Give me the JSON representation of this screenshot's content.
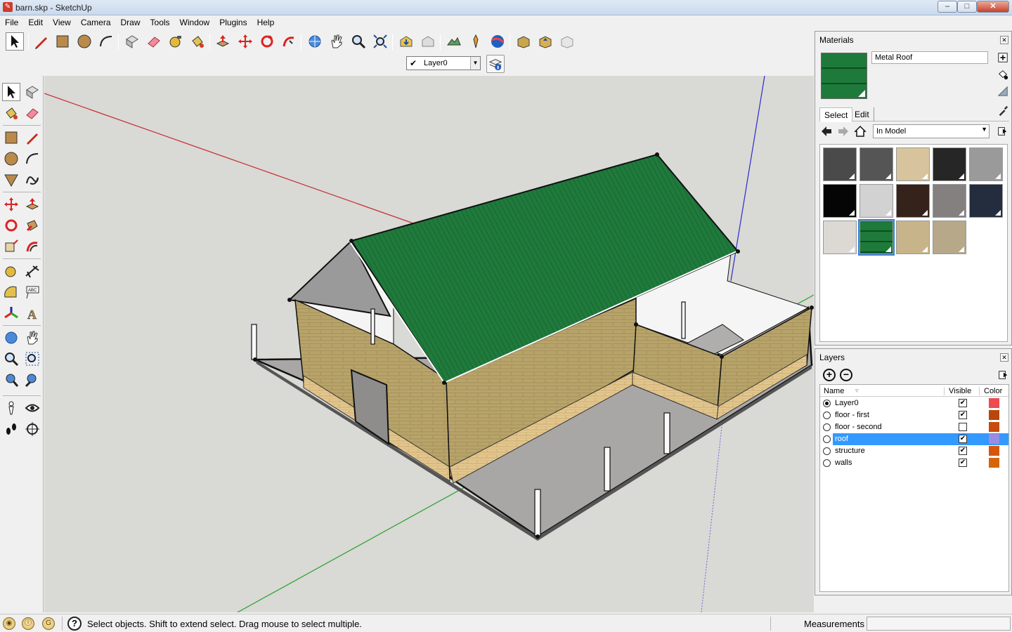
{
  "window": {
    "title": "barn.skp - SketchUp",
    "min": "‒",
    "max": "□",
    "close": "✕"
  },
  "menu": [
    "File",
    "Edit",
    "View",
    "Camera",
    "Draw",
    "Tools",
    "Window",
    "Plugins",
    "Help"
  ],
  "layer_toolbar": {
    "current_layer": "Layer0",
    "visible_check": "✔"
  },
  "status": {
    "help_glyph": "?",
    "message": "Select objects. Shift to extend select. Drag mouse to select multiple.",
    "measurements_label": "Measurements",
    "measurements_value": ""
  },
  "materials": {
    "panel_title": "Materials",
    "close": "✕",
    "selected_name": "Metal Roof",
    "tabs": [
      "Select",
      "Edit"
    ],
    "library": "In Model",
    "swatches": [
      {
        "color": "#4a4a4a"
      },
      {
        "color": "#555555"
      },
      {
        "color": "#d8c49c"
      },
      {
        "color": "#262626"
      },
      {
        "color": "#9a9a9a"
      },
      {
        "color": "#050505"
      },
      {
        "color": "#d2d2d2"
      },
      {
        "color": "#35221a"
      },
      {
        "color": "#858080"
      },
      {
        "color": "#232d3e"
      },
      {
        "color": "#dcd8d4"
      },
      {
        "color": "#1e7a3a",
        "selected": true
      },
      {
        "color": "#c8b48a"
      },
      {
        "color": "#b6a888"
      }
    ]
  },
  "layers": {
    "panel_title": "Layers",
    "close": "✕",
    "add": "+",
    "remove": "−",
    "columns": {
      "name": "Name",
      "visible": "Visible",
      "color": "Color"
    },
    "rows": [
      {
        "name": "Layer0",
        "current": true,
        "visible": true,
        "color": "#ee4a52"
      },
      {
        "name": "floor - first",
        "current": false,
        "visible": true,
        "color": "#b9460a"
      },
      {
        "name": "floor - second",
        "current": false,
        "visible": false,
        "color": "#c84a0c"
      },
      {
        "name": "roof",
        "current": false,
        "visible": true,
        "color": "#9a8ce0",
        "selected": true
      },
      {
        "name": "structure",
        "current": false,
        "visible": true,
        "color": "#d4560a"
      },
      {
        "name": "walls",
        "current": false,
        "visible": true,
        "color": "#d6650a"
      }
    ]
  }
}
